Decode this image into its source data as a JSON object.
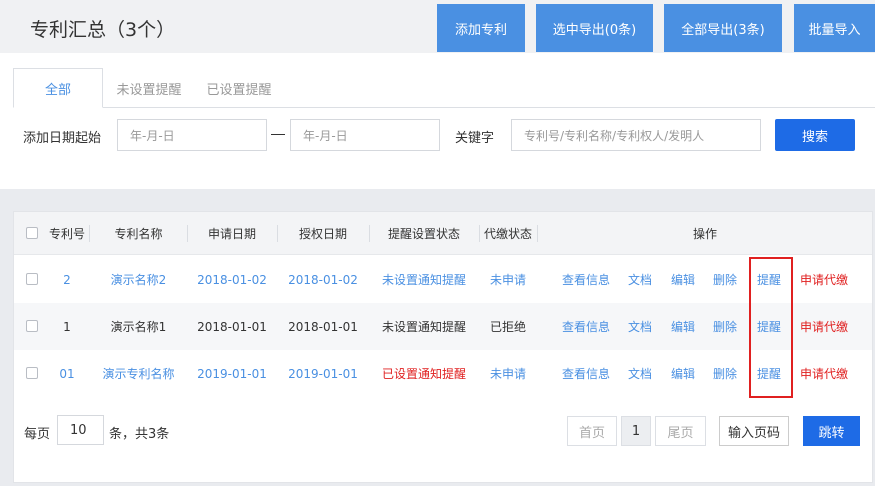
{
  "header": {
    "title": "专利汇总（3个）",
    "buttons": [
      "添加专利",
      "选中导出(0条)",
      "全部导出(3条)",
      "批量导入"
    ]
  },
  "tabs": [
    "全部",
    "未设置提醒",
    "已设置提醒"
  ],
  "filters": {
    "date_label": "添加日期起始",
    "date_start_placeholder": "年-月-日",
    "date_end_placeholder": "年-月-日",
    "keyword_label": "关键字",
    "keyword_placeholder": "专利号/专利名称/专利权人/发明人",
    "search_button": "搜索"
  },
  "table": {
    "headers": [
      "专利号",
      "专利名称",
      "申请日期",
      "授权日期",
      "提醒设置状态",
      "代缴状态",
      "操作"
    ],
    "actions": [
      "查看信息",
      "文档",
      "编辑",
      "删除",
      "提醒",
      "申请代缴"
    ],
    "rows": [
      {
        "no": "2",
        "name": "演示名称2",
        "apply_date": "2018-01-02",
        "grant_date": "2018-01-02",
        "remind": "未设置通知提醒",
        "pay": "未申请"
      },
      {
        "no": "1",
        "name": "演示名称1",
        "apply_date": "2018-01-01",
        "grant_date": "2018-01-01",
        "remind": "未设置通知提醒",
        "pay": "已拒绝"
      },
      {
        "no": "01",
        "name": "演示专利名称",
        "apply_date": "2019-01-01",
        "grant_date": "2019-01-01",
        "remind": "已设置通知提醒",
        "pay": "未申请"
      }
    ]
  },
  "pagination": {
    "per_page_label": "每页",
    "per_page_value": "10",
    "total_label": "条，共3条",
    "first": "首页",
    "current": "1",
    "last": "尾页",
    "page_input_placeholder": "输入页码",
    "jump": "跳转"
  },
  "colors": {
    "accent": "#4a90e2",
    "primary_button": "#1e6be6",
    "danger": "#e02020"
  }
}
